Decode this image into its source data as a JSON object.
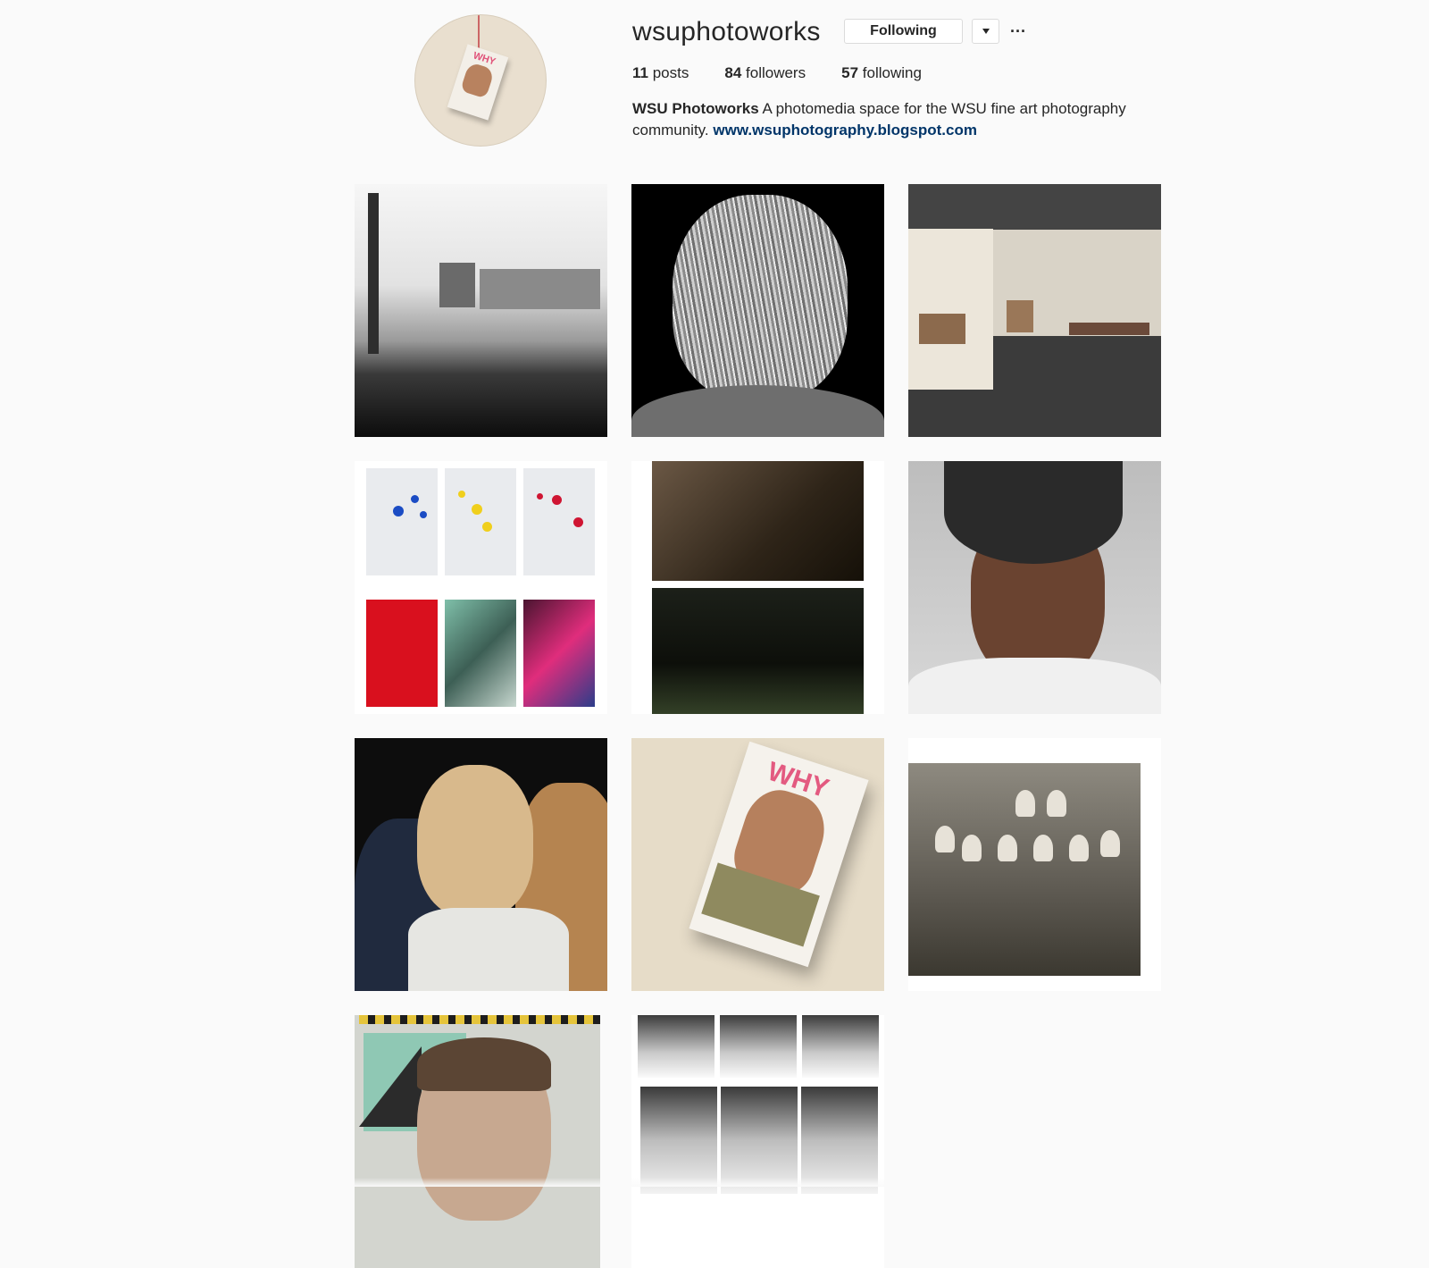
{
  "profile": {
    "username": "wsuphotoworks",
    "follow_button_label": "Following",
    "more_button_label": "···",
    "stats": {
      "posts_count": "11",
      "posts_label": "posts",
      "followers_count": "84",
      "followers_label": "followers",
      "following_count": "57",
      "following_label": "following"
    },
    "bio": {
      "name": "WSU Photoworks",
      "text": " A photomedia space for the WSU fine art photography community. ",
      "link": "www.wsuphotography.blogspot.com"
    },
    "avatar": {
      "cover_text": "WHY"
    }
  },
  "posts": {
    "zine_cover_text": "WHY"
  },
  "colors": {
    "background": "#fafafa",
    "text": "#262626",
    "link": "#003569",
    "border": "#dbdbdb"
  }
}
